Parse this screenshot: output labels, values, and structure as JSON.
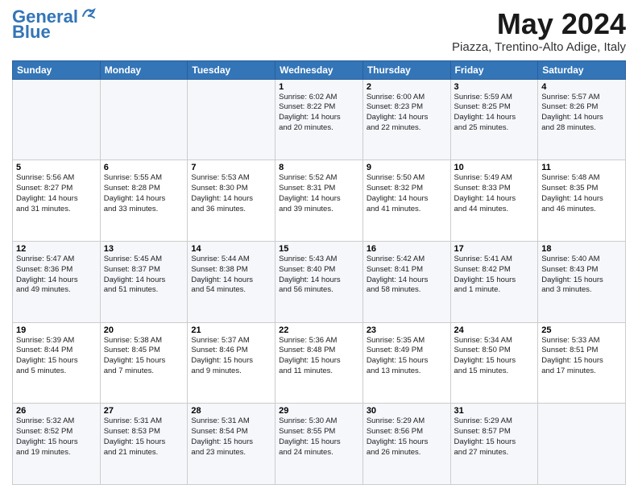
{
  "header": {
    "logo_line1": "General",
    "logo_line2": "Blue",
    "month": "May 2024",
    "location": "Piazza, Trentino-Alto Adige, Italy"
  },
  "days_of_week": [
    "Sunday",
    "Monday",
    "Tuesday",
    "Wednesday",
    "Thursday",
    "Friday",
    "Saturday"
  ],
  "weeks": [
    [
      {
        "day": "",
        "info": ""
      },
      {
        "day": "",
        "info": ""
      },
      {
        "day": "",
        "info": ""
      },
      {
        "day": "1",
        "info": "Sunrise: 6:02 AM\nSunset: 8:22 PM\nDaylight: 14 hours\nand 20 minutes."
      },
      {
        "day": "2",
        "info": "Sunrise: 6:00 AM\nSunset: 8:23 PM\nDaylight: 14 hours\nand 22 minutes."
      },
      {
        "day": "3",
        "info": "Sunrise: 5:59 AM\nSunset: 8:25 PM\nDaylight: 14 hours\nand 25 minutes."
      },
      {
        "day": "4",
        "info": "Sunrise: 5:57 AM\nSunset: 8:26 PM\nDaylight: 14 hours\nand 28 minutes."
      }
    ],
    [
      {
        "day": "5",
        "info": "Sunrise: 5:56 AM\nSunset: 8:27 PM\nDaylight: 14 hours\nand 31 minutes."
      },
      {
        "day": "6",
        "info": "Sunrise: 5:55 AM\nSunset: 8:28 PM\nDaylight: 14 hours\nand 33 minutes."
      },
      {
        "day": "7",
        "info": "Sunrise: 5:53 AM\nSunset: 8:30 PM\nDaylight: 14 hours\nand 36 minutes."
      },
      {
        "day": "8",
        "info": "Sunrise: 5:52 AM\nSunset: 8:31 PM\nDaylight: 14 hours\nand 39 minutes."
      },
      {
        "day": "9",
        "info": "Sunrise: 5:50 AM\nSunset: 8:32 PM\nDaylight: 14 hours\nand 41 minutes."
      },
      {
        "day": "10",
        "info": "Sunrise: 5:49 AM\nSunset: 8:33 PM\nDaylight: 14 hours\nand 44 minutes."
      },
      {
        "day": "11",
        "info": "Sunrise: 5:48 AM\nSunset: 8:35 PM\nDaylight: 14 hours\nand 46 minutes."
      }
    ],
    [
      {
        "day": "12",
        "info": "Sunrise: 5:47 AM\nSunset: 8:36 PM\nDaylight: 14 hours\nand 49 minutes."
      },
      {
        "day": "13",
        "info": "Sunrise: 5:45 AM\nSunset: 8:37 PM\nDaylight: 14 hours\nand 51 minutes."
      },
      {
        "day": "14",
        "info": "Sunrise: 5:44 AM\nSunset: 8:38 PM\nDaylight: 14 hours\nand 54 minutes."
      },
      {
        "day": "15",
        "info": "Sunrise: 5:43 AM\nSunset: 8:40 PM\nDaylight: 14 hours\nand 56 minutes."
      },
      {
        "day": "16",
        "info": "Sunrise: 5:42 AM\nSunset: 8:41 PM\nDaylight: 14 hours\nand 58 minutes."
      },
      {
        "day": "17",
        "info": "Sunrise: 5:41 AM\nSunset: 8:42 PM\nDaylight: 15 hours\nand 1 minute."
      },
      {
        "day": "18",
        "info": "Sunrise: 5:40 AM\nSunset: 8:43 PM\nDaylight: 15 hours\nand 3 minutes."
      }
    ],
    [
      {
        "day": "19",
        "info": "Sunrise: 5:39 AM\nSunset: 8:44 PM\nDaylight: 15 hours\nand 5 minutes."
      },
      {
        "day": "20",
        "info": "Sunrise: 5:38 AM\nSunset: 8:45 PM\nDaylight: 15 hours\nand 7 minutes."
      },
      {
        "day": "21",
        "info": "Sunrise: 5:37 AM\nSunset: 8:46 PM\nDaylight: 15 hours\nand 9 minutes."
      },
      {
        "day": "22",
        "info": "Sunrise: 5:36 AM\nSunset: 8:48 PM\nDaylight: 15 hours\nand 11 minutes."
      },
      {
        "day": "23",
        "info": "Sunrise: 5:35 AM\nSunset: 8:49 PM\nDaylight: 15 hours\nand 13 minutes."
      },
      {
        "day": "24",
        "info": "Sunrise: 5:34 AM\nSunset: 8:50 PM\nDaylight: 15 hours\nand 15 minutes."
      },
      {
        "day": "25",
        "info": "Sunrise: 5:33 AM\nSunset: 8:51 PM\nDaylight: 15 hours\nand 17 minutes."
      }
    ],
    [
      {
        "day": "26",
        "info": "Sunrise: 5:32 AM\nSunset: 8:52 PM\nDaylight: 15 hours\nand 19 minutes."
      },
      {
        "day": "27",
        "info": "Sunrise: 5:31 AM\nSunset: 8:53 PM\nDaylight: 15 hours\nand 21 minutes."
      },
      {
        "day": "28",
        "info": "Sunrise: 5:31 AM\nSunset: 8:54 PM\nDaylight: 15 hours\nand 23 minutes."
      },
      {
        "day": "29",
        "info": "Sunrise: 5:30 AM\nSunset: 8:55 PM\nDaylight: 15 hours\nand 24 minutes."
      },
      {
        "day": "30",
        "info": "Sunrise: 5:29 AM\nSunset: 8:56 PM\nDaylight: 15 hours\nand 26 minutes."
      },
      {
        "day": "31",
        "info": "Sunrise: 5:29 AM\nSunset: 8:57 PM\nDaylight: 15 hours\nand 27 minutes."
      },
      {
        "day": "",
        "info": ""
      }
    ]
  ]
}
